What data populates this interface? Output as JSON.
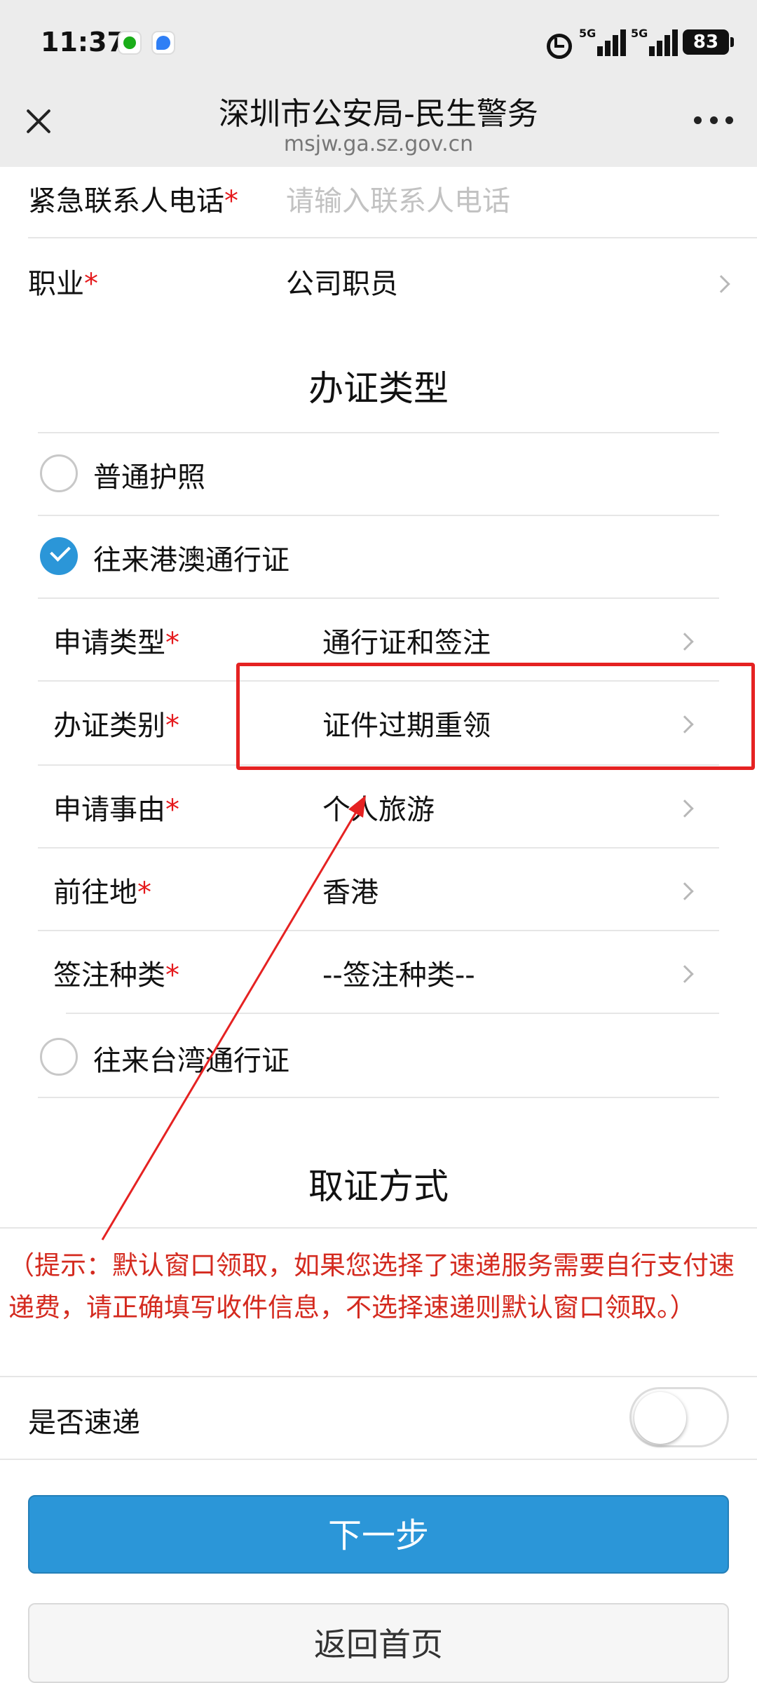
{
  "status_bar": {
    "time": "11:37",
    "network_1": "5G",
    "network_2": "5G",
    "battery": "83"
  },
  "header": {
    "title": "深圳市公安局-民生警务",
    "url": "msjw.ga.sz.gov.cn"
  },
  "form": {
    "emergency_phone": {
      "label": "紧急联系人电话",
      "required": "*",
      "placeholder": "请输入联系人电话"
    },
    "occupation": {
      "label": "职业",
      "required": "*",
      "value": "公司职员"
    }
  },
  "permit_section": {
    "title": "办证类型",
    "options": [
      {
        "label": "普通护照",
        "checked": false
      },
      {
        "label": "往来港澳通行证",
        "checked": true
      },
      {
        "label": "往来台湾通行证",
        "checked": false
      }
    ],
    "fields": [
      {
        "label": "申请类型",
        "required": "*",
        "value": "通行证和签注"
      },
      {
        "label": "办证类别",
        "required": "*",
        "value": "证件过期重领"
      },
      {
        "label": "申请事由",
        "required": "*",
        "value": "个人旅游"
      },
      {
        "label": "前往地",
        "required": "*",
        "value": "香港"
      },
      {
        "label": "签注种类",
        "required": "*",
        "value": "--签注种类--"
      }
    ]
  },
  "pickup_section": {
    "title": "取证方式",
    "tip": "（提示：默认窗口领取，如果您选择了速递服务需要自行支付速递费，请正确填写收件信息，不选择速递则默认窗口领取。）",
    "express": {
      "label": "是否速递",
      "enabled": false
    }
  },
  "buttons": {
    "next": "下一步",
    "home": "返回首页"
  },
  "colors": {
    "accent": "#2b96d8",
    "required": "#e5191c",
    "annotation": "#e52222",
    "tip_text": "#d42a1f"
  }
}
